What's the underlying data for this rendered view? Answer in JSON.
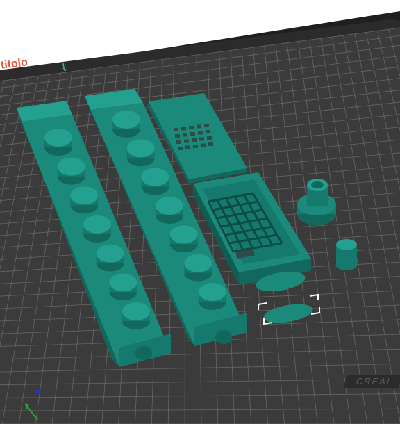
{
  "app": {
    "brand_text": "titolo",
    "brand_mark_icon": "leaf-icon"
  },
  "plate": {
    "label": "CREAL",
    "colors": {
      "background": "#ffffff",
      "plate": "#3b3b3b",
      "plate_edge": "#1e1e1e",
      "grid_line": "#8c8c8c",
      "part": "#1b8a7b",
      "part_light": "#24a090",
      "part_dark": "#12685d",
      "selection": "#ffffff",
      "axis_y": "#1a37c8",
      "axis_x": "#2aa53a"
    }
  },
  "parts": [
    {
      "name": "key-bar-left",
      "pegs": 7
    },
    {
      "name": "key-bar-right",
      "pegs": 7
    },
    {
      "name": "box-lid"
    },
    {
      "name": "grid-box"
    },
    {
      "name": "tall-knob"
    },
    {
      "name": "small-cylinder"
    },
    {
      "name": "oval-button"
    },
    {
      "name": "oval-button-selected",
      "selected": true
    }
  ],
  "gizmo": {
    "icon": "axis-gizmo-icon"
  }
}
